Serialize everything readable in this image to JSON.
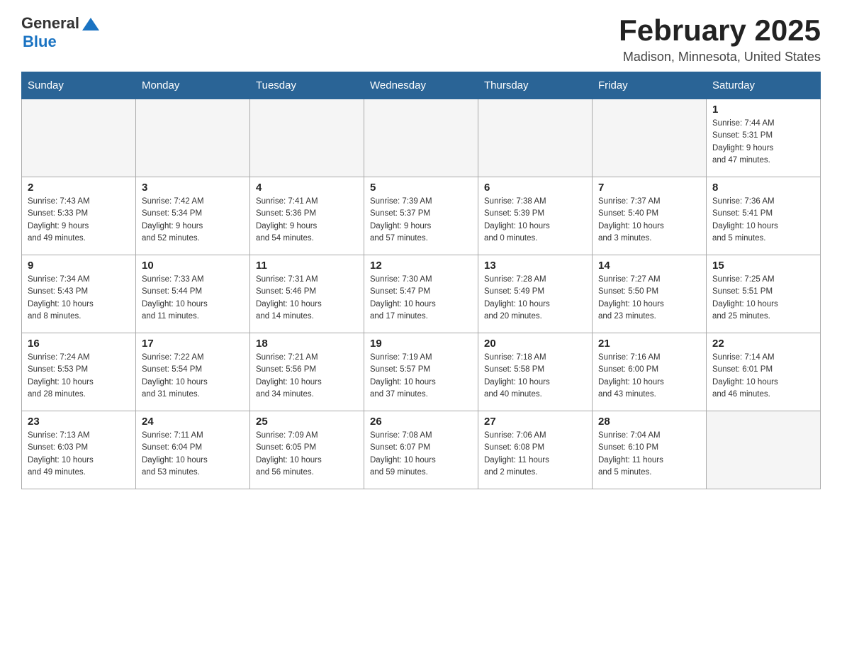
{
  "header": {
    "logo_text_general": "General",
    "logo_text_blue": "Blue",
    "title": "February 2025",
    "subtitle": "Madison, Minnesota, United States"
  },
  "days_of_week": [
    "Sunday",
    "Monday",
    "Tuesday",
    "Wednesday",
    "Thursday",
    "Friday",
    "Saturday"
  ],
  "weeks": [
    {
      "days": [
        {
          "number": "",
          "info": ""
        },
        {
          "number": "",
          "info": ""
        },
        {
          "number": "",
          "info": ""
        },
        {
          "number": "",
          "info": ""
        },
        {
          "number": "",
          "info": ""
        },
        {
          "number": "",
          "info": ""
        },
        {
          "number": "1",
          "info": "Sunrise: 7:44 AM\nSunset: 5:31 PM\nDaylight: 9 hours\nand 47 minutes."
        }
      ]
    },
    {
      "days": [
        {
          "number": "2",
          "info": "Sunrise: 7:43 AM\nSunset: 5:33 PM\nDaylight: 9 hours\nand 49 minutes."
        },
        {
          "number": "3",
          "info": "Sunrise: 7:42 AM\nSunset: 5:34 PM\nDaylight: 9 hours\nand 52 minutes."
        },
        {
          "number": "4",
          "info": "Sunrise: 7:41 AM\nSunset: 5:36 PM\nDaylight: 9 hours\nand 54 minutes."
        },
        {
          "number": "5",
          "info": "Sunrise: 7:39 AM\nSunset: 5:37 PM\nDaylight: 9 hours\nand 57 minutes."
        },
        {
          "number": "6",
          "info": "Sunrise: 7:38 AM\nSunset: 5:39 PM\nDaylight: 10 hours\nand 0 minutes."
        },
        {
          "number": "7",
          "info": "Sunrise: 7:37 AM\nSunset: 5:40 PM\nDaylight: 10 hours\nand 3 minutes."
        },
        {
          "number": "8",
          "info": "Sunrise: 7:36 AM\nSunset: 5:41 PM\nDaylight: 10 hours\nand 5 minutes."
        }
      ]
    },
    {
      "days": [
        {
          "number": "9",
          "info": "Sunrise: 7:34 AM\nSunset: 5:43 PM\nDaylight: 10 hours\nand 8 minutes."
        },
        {
          "number": "10",
          "info": "Sunrise: 7:33 AM\nSunset: 5:44 PM\nDaylight: 10 hours\nand 11 minutes."
        },
        {
          "number": "11",
          "info": "Sunrise: 7:31 AM\nSunset: 5:46 PM\nDaylight: 10 hours\nand 14 minutes."
        },
        {
          "number": "12",
          "info": "Sunrise: 7:30 AM\nSunset: 5:47 PM\nDaylight: 10 hours\nand 17 minutes."
        },
        {
          "number": "13",
          "info": "Sunrise: 7:28 AM\nSunset: 5:49 PM\nDaylight: 10 hours\nand 20 minutes."
        },
        {
          "number": "14",
          "info": "Sunrise: 7:27 AM\nSunset: 5:50 PM\nDaylight: 10 hours\nand 23 minutes."
        },
        {
          "number": "15",
          "info": "Sunrise: 7:25 AM\nSunset: 5:51 PM\nDaylight: 10 hours\nand 25 minutes."
        }
      ]
    },
    {
      "days": [
        {
          "number": "16",
          "info": "Sunrise: 7:24 AM\nSunset: 5:53 PM\nDaylight: 10 hours\nand 28 minutes."
        },
        {
          "number": "17",
          "info": "Sunrise: 7:22 AM\nSunset: 5:54 PM\nDaylight: 10 hours\nand 31 minutes."
        },
        {
          "number": "18",
          "info": "Sunrise: 7:21 AM\nSunset: 5:56 PM\nDaylight: 10 hours\nand 34 minutes."
        },
        {
          "number": "19",
          "info": "Sunrise: 7:19 AM\nSunset: 5:57 PM\nDaylight: 10 hours\nand 37 minutes."
        },
        {
          "number": "20",
          "info": "Sunrise: 7:18 AM\nSunset: 5:58 PM\nDaylight: 10 hours\nand 40 minutes."
        },
        {
          "number": "21",
          "info": "Sunrise: 7:16 AM\nSunset: 6:00 PM\nDaylight: 10 hours\nand 43 minutes."
        },
        {
          "number": "22",
          "info": "Sunrise: 7:14 AM\nSunset: 6:01 PM\nDaylight: 10 hours\nand 46 minutes."
        }
      ]
    },
    {
      "days": [
        {
          "number": "23",
          "info": "Sunrise: 7:13 AM\nSunset: 6:03 PM\nDaylight: 10 hours\nand 49 minutes."
        },
        {
          "number": "24",
          "info": "Sunrise: 7:11 AM\nSunset: 6:04 PM\nDaylight: 10 hours\nand 53 minutes."
        },
        {
          "number": "25",
          "info": "Sunrise: 7:09 AM\nSunset: 6:05 PM\nDaylight: 10 hours\nand 56 minutes."
        },
        {
          "number": "26",
          "info": "Sunrise: 7:08 AM\nSunset: 6:07 PM\nDaylight: 10 hours\nand 59 minutes."
        },
        {
          "number": "27",
          "info": "Sunrise: 7:06 AM\nSunset: 6:08 PM\nDaylight: 11 hours\nand 2 minutes."
        },
        {
          "number": "28",
          "info": "Sunrise: 7:04 AM\nSunset: 6:10 PM\nDaylight: 11 hours\nand 5 minutes."
        },
        {
          "number": "",
          "info": ""
        }
      ]
    }
  ],
  "accent_color": "#2a6496"
}
